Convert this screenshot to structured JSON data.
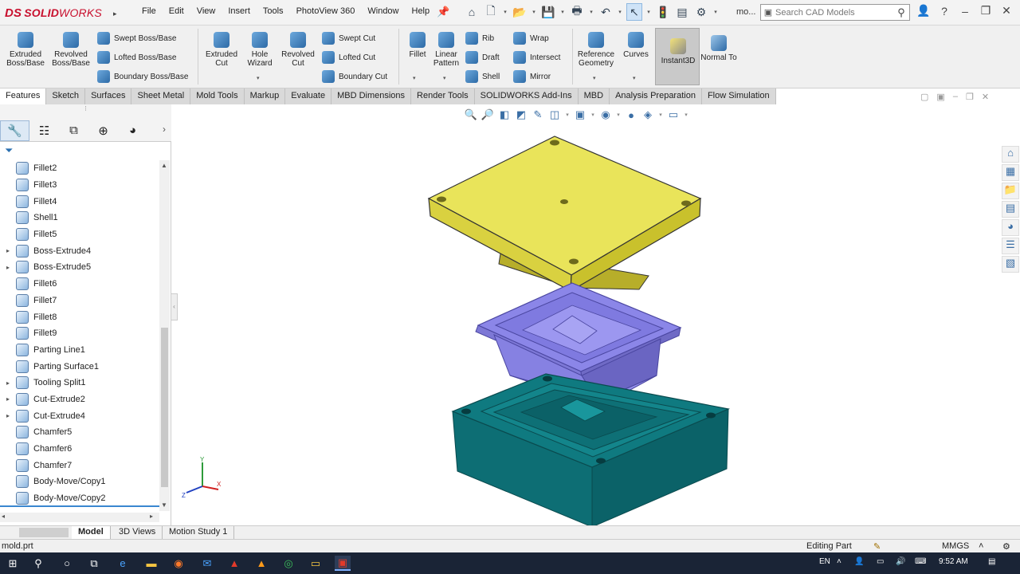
{
  "app": {
    "logo_prefix": "DS",
    "logo_text": "SOLID",
    "logo_text2": "WORKS"
  },
  "menu": [
    "File",
    "Edit",
    "View",
    "Insert",
    "Tools",
    "PhotoView 360",
    "Window",
    "Help"
  ],
  "docname": "mo...",
  "search": {
    "placeholder": "Search CAD Models"
  },
  "commands": {
    "extruded_boss": "Extruded Boss/Base",
    "revolved_boss": "Revolved Boss/Base",
    "swept_boss": "Swept Boss/Base",
    "lofted_boss": "Lofted Boss/Base",
    "boundary_boss": "Boundary Boss/Base",
    "extruded_cut": "Extruded Cut",
    "hole_wizard": "Hole Wizard",
    "revolved_cut": "Revolved Cut",
    "swept_cut": "Swept Cut",
    "lofted_cut": "Lofted Cut",
    "boundary_cut": "Boundary Cut",
    "fillet": "Fillet",
    "linear_pattern": "Linear Pattern",
    "rib": "Rib",
    "wrap": "Wrap",
    "draft": "Draft",
    "intersect": "Intersect",
    "shell": "Shell",
    "mirror": "Mirror",
    "reference_geometry": "Reference Geometry",
    "curves": "Curves",
    "instant3d": "Instant3D",
    "normal_to": "Normal To"
  },
  "tabs": [
    "Features",
    "Sketch",
    "Surfaces",
    "Sheet Metal",
    "Mold Tools",
    "Markup",
    "Evaluate",
    "MBD Dimensions",
    "Render Tools",
    "SOLIDWORKS Add-Ins",
    "MBD",
    "Analysis Preparation",
    "Flow Simulation"
  ],
  "active_tab": "Features",
  "tree": [
    {
      "label": "Fillet2",
      "expand": ""
    },
    {
      "label": "Fillet3",
      "expand": ""
    },
    {
      "label": "Fillet4",
      "expand": ""
    },
    {
      "label": "Shell1",
      "expand": ""
    },
    {
      "label": "Fillet5",
      "expand": ""
    },
    {
      "label": "Boss-Extrude4",
      "expand": "▸"
    },
    {
      "label": "Boss-Extrude5",
      "expand": "▸"
    },
    {
      "label": "Fillet6",
      "expand": ""
    },
    {
      "label": "Fillet7",
      "expand": ""
    },
    {
      "label": "Fillet8",
      "expand": ""
    },
    {
      "label": "Fillet9",
      "expand": ""
    },
    {
      "label": "Parting Line1",
      "expand": ""
    },
    {
      "label": "Parting Surface1",
      "expand": ""
    },
    {
      "label": "Tooling Split1",
      "expand": "▸"
    },
    {
      "label": "Cut-Extrude2",
      "expand": "▸"
    },
    {
      "label": "Cut-Extrude4",
      "expand": "▸"
    },
    {
      "label": "Chamfer5",
      "expand": ""
    },
    {
      "label": "Chamfer6",
      "expand": ""
    },
    {
      "label": "Chamfer7",
      "expand": ""
    },
    {
      "label": "Body-Move/Copy1",
      "expand": ""
    },
    {
      "label": "Body-Move/Copy2",
      "expand": ""
    }
  ],
  "bottom_tabs": [
    "Model",
    "3D Views",
    "Motion Study 1"
  ],
  "status": {
    "file": "mold.prt",
    "mode": "Editing Part",
    "units": "MMGS"
  },
  "taskbar": {
    "lang": "EN",
    "time": "9:52 AM"
  },
  "colors": {
    "core": "#e9e45a",
    "part": "#8b86e8",
    "cavity": "#0f7a80",
    "accent": "#c8102e"
  }
}
